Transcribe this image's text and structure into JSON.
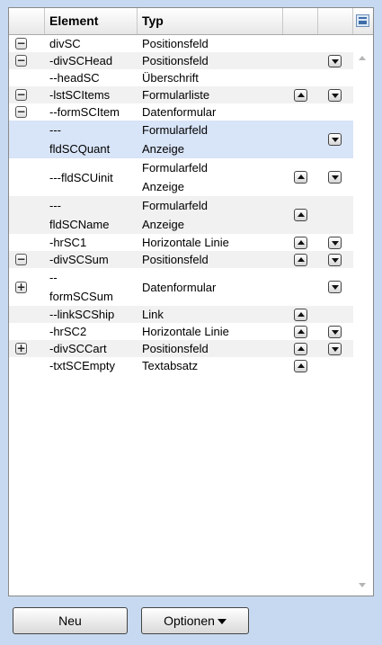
{
  "table": {
    "headers": {
      "element": "Element",
      "typ": "Typ"
    },
    "rows": [
      {
        "toggle": "minus",
        "element": "divSC",
        "typ": "Positionsfeld",
        "up": false,
        "down": false
      },
      {
        "toggle": "minus",
        "element": "-divSCHead",
        "typ": "Positionsfeld",
        "up": false,
        "down": true
      },
      {
        "toggle": "",
        "element": "--headSC",
        "typ": "Überschrift",
        "up": false,
        "down": false
      },
      {
        "toggle": "minus",
        "element": "-lstSCItems",
        "typ": "Formularliste",
        "up": true,
        "down": true
      },
      {
        "toggle": "minus",
        "element": "--formSCItem",
        "typ": "Datenformular",
        "up": false,
        "down": false
      },
      {
        "toggle": "",
        "element_line1": "---",
        "element_line2": "fldSCQuant",
        "typ_line1": "Formularfeld",
        "typ_line2": "Anzeige",
        "up": false,
        "down": true,
        "selected": true
      },
      {
        "toggle": "",
        "element": "---fldSCUinit",
        "typ_line1": "Formularfeld",
        "typ_line2": "Anzeige",
        "up": true,
        "down": true
      },
      {
        "toggle": "",
        "element_line1": "---",
        "element_line2": "fldSCName",
        "typ_line1": "Formularfeld",
        "typ_line2": "Anzeige",
        "up": true,
        "down": false
      },
      {
        "toggle": "",
        "element": "-hrSC1",
        "typ": "Horizontale Linie",
        "up": true,
        "down": true
      },
      {
        "toggle": "minus",
        "element": "-divSCSum",
        "typ": "Positionsfeld",
        "up": true,
        "down": true
      },
      {
        "toggle": "plus",
        "element_line1": "--",
        "element_line2": "formSCSum",
        "typ": "Datenformular",
        "up": false,
        "down": true
      },
      {
        "toggle": "",
        "element": "--linkSCShip",
        "typ": "Link",
        "up": true,
        "down": false
      },
      {
        "toggle": "",
        "element": "-hrSC2",
        "typ": "Horizontale Linie",
        "up": true,
        "down": true
      },
      {
        "toggle": "plus",
        "element": "-divSCCart",
        "typ": "Positionsfeld",
        "up": true,
        "down": true
      },
      {
        "toggle": "",
        "element": "-txtSCEmpty",
        "typ": "Textabsatz",
        "up": true,
        "down": false
      }
    ]
  },
  "footer": {
    "new_label": "Neu",
    "options_label": "Optionen"
  },
  "icons": {
    "toggle_minus": "collapse-icon",
    "toggle_plus": "expand-icon",
    "up": "move-up-icon",
    "down": "move-down-icon",
    "columns": "column-settings-icon"
  }
}
